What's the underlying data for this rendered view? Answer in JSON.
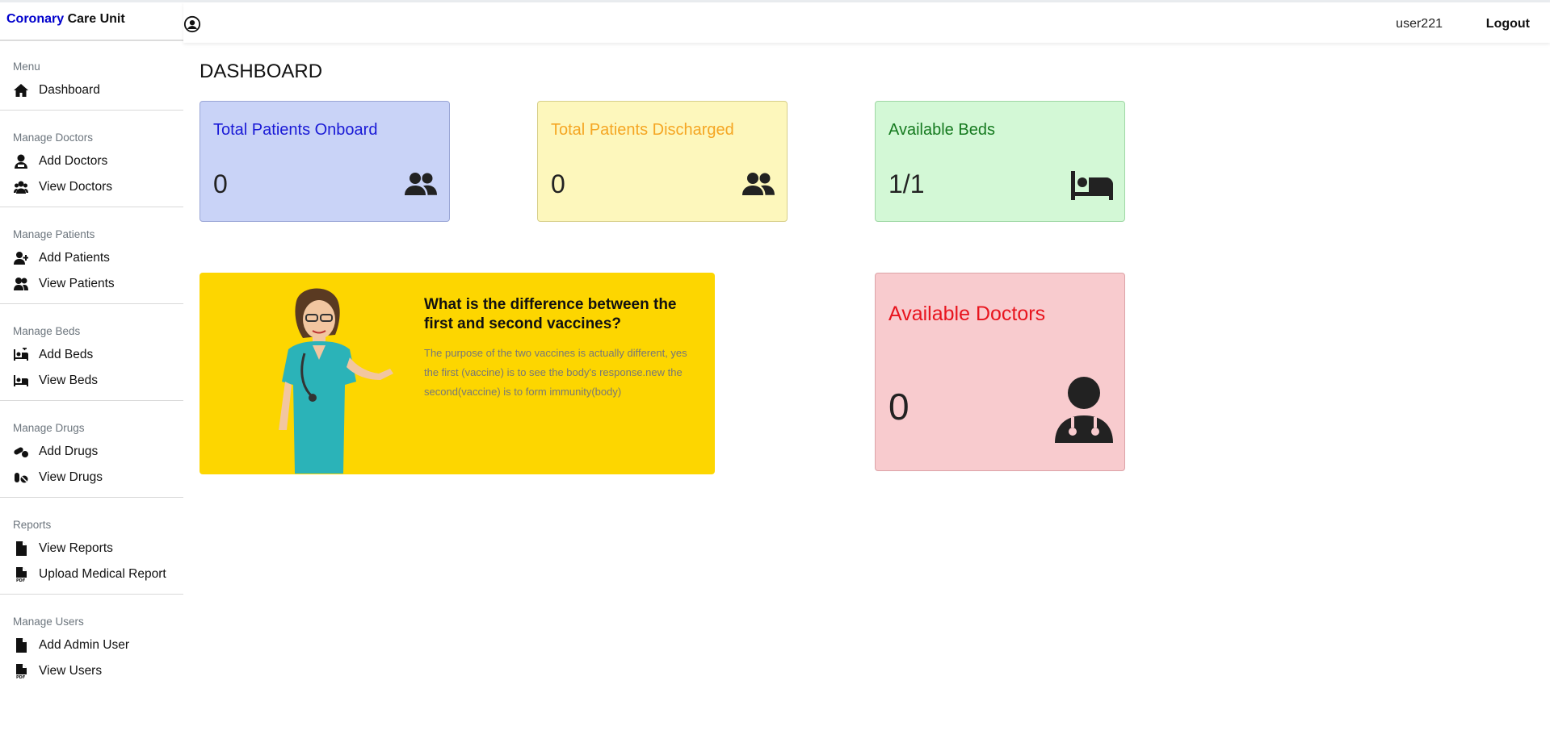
{
  "sidebar": {
    "brand": {
      "part1": "Coronary",
      "part2": " Care Unit"
    },
    "sections": [
      {
        "title": "Menu",
        "items": [
          {
            "label": "Dashboard",
            "icon": "home-icon"
          }
        ]
      },
      {
        "title": "Manage Doctors",
        "items": [
          {
            "label": "Add Doctors",
            "icon": "doctor-icon"
          },
          {
            "label": "View Doctors",
            "icon": "users-icon"
          }
        ]
      },
      {
        "title": "Manage Patients",
        "items": [
          {
            "label": "Add Patients",
            "icon": "user-plus-icon"
          },
          {
            "label": "View Patients",
            "icon": "user-group-icon"
          }
        ]
      },
      {
        "title": "Manage Beds",
        "items": [
          {
            "label": "Add Beds",
            "icon": "bed-plus-icon"
          },
          {
            "label": "View Beds",
            "icon": "bed-icon"
          }
        ]
      },
      {
        "title": "Manage Drugs",
        "items": [
          {
            "label": "Add Drugs",
            "icon": "pills-icon"
          },
          {
            "label": "View Drugs",
            "icon": "capsules-icon"
          }
        ]
      },
      {
        "title": "Reports",
        "items": [
          {
            "label": "View Reports",
            "icon": "file-icon"
          },
          {
            "label": "Upload Medical Report",
            "icon": "file-pdf-icon"
          }
        ]
      },
      {
        "title": "Manage Users",
        "items": [
          {
            "label": "Add Admin User",
            "icon": "file-icon"
          },
          {
            "label": "View Users",
            "icon": "file-pdf-icon"
          }
        ]
      }
    ]
  },
  "header": {
    "username": "user221",
    "logout": "Logout"
  },
  "page": {
    "title": "DASHBOARD"
  },
  "cards": {
    "onboard": {
      "title": "Total Patients Onboard",
      "value": "0"
    },
    "discharged": {
      "title": "Total Patients Discharged",
      "value": "0"
    },
    "beds": {
      "title": "Available Beds",
      "value": "1/1"
    },
    "doctors": {
      "title": "Available Doctors",
      "value": "0"
    }
  },
  "banner": {
    "question": "What is the difference between the first and second vaccines?",
    "answer": "The purpose of the two vaccines is actually different, yes the first (vaccine) is to see the body's response.new the second(vaccine) is to form immunity(body)"
  },
  "colors": {
    "onboard_bg": "#c9d3f7",
    "discharged_bg": "#fdf7bc",
    "beds_bg": "#d3f8d6",
    "doctors_bg": "#f8cbce",
    "banner_bg": "#fdd600"
  }
}
